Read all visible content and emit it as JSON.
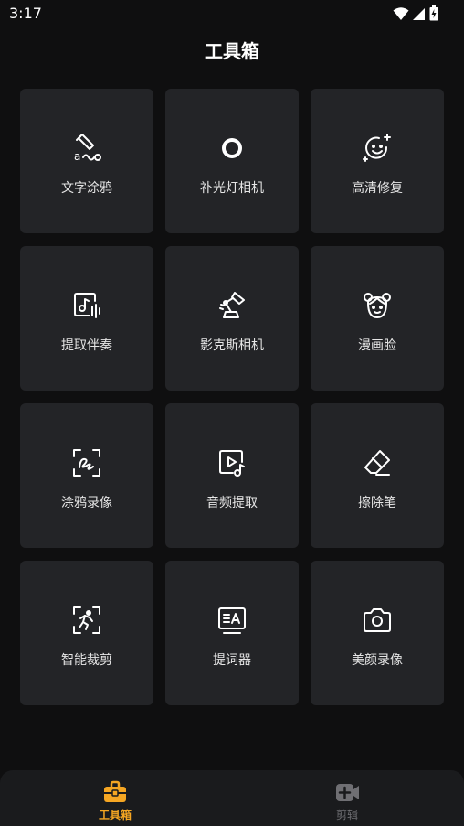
{
  "status_bar": {
    "time": "3:17"
  },
  "header": {
    "title": "工具箱"
  },
  "tools": [
    {
      "label": "文字涂鸦",
      "icon": "text-doodle-icon"
    },
    {
      "label": "补光灯相机",
      "icon": "fill-light-icon"
    },
    {
      "label": "高清修复",
      "icon": "hd-repair-icon"
    },
    {
      "label": "提取伴奏",
      "icon": "extract-accompaniment-icon"
    },
    {
      "label": "影克斯相机",
      "icon": "desk-lamp-icon"
    },
    {
      "label": "漫画脸",
      "icon": "comic-face-icon"
    },
    {
      "label": "涂鸦录像",
      "icon": "doodle-record-icon"
    },
    {
      "label": "音频提取",
      "icon": "audio-extract-icon"
    },
    {
      "label": "擦除笔",
      "icon": "eraser-icon"
    },
    {
      "label": "智能裁剪",
      "icon": "smart-crop-icon"
    },
    {
      "label": "提词器",
      "icon": "teleprompter-icon"
    },
    {
      "label": "美颜录像",
      "icon": "camera-icon"
    }
  ],
  "bottom_nav": {
    "items": [
      {
        "label": "工具箱",
        "icon": "toolbox-icon",
        "active": true,
        "color": "#f5a623"
      },
      {
        "label": "剪辑",
        "icon": "video-edit-icon",
        "active": false,
        "color": "#6f6f73"
      }
    ]
  }
}
